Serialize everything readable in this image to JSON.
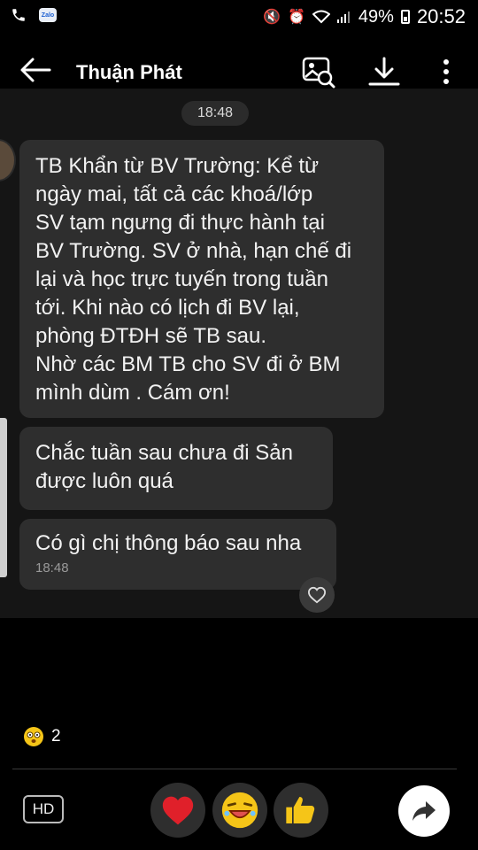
{
  "status_bar": {
    "app_badge": "Zalo",
    "battery": "49%",
    "time": "20:52"
  },
  "header": {
    "title": "Thuận Phát",
    "actions": [
      "search-media-icon",
      "download-icon",
      "more-vertical-icon"
    ]
  },
  "chat": {
    "time_separator": "18:48",
    "messages": [
      {
        "lines": [
          "TB Khẩn từ BV Trường: Kể từ",
          "ngày mai, tất cả các khoá/lớp",
          "SV tạm ngưng đi thực hành tại",
          "BV Trường. SV ở nhà, hạn chế đi",
          "lại và học trực tuyến trong tuần",
          "tới. Khi nào có lịch đi BV lại,",
          "phòng ĐTĐH sẽ TB sau.",
          "Nhờ các BM TB cho SV đi ở BM",
          "mình dùm . Cám ơn!"
        ]
      },
      {
        "lines": [
          "Chắc tuần sau chưa đi Sản",
          "được luôn quá"
        ]
      },
      {
        "lines": [
          "Có gì chị thông báo sau nha"
        ],
        "time": "18:48"
      }
    ]
  },
  "reactions": {
    "count": "2",
    "icon": "dizzy-face-icon"
  },
  "bottom_bar": {
    "hd_label": "HD",
    "emoji_buttons": [
      "heart-icon",
      "laughing-face-icon",
      "thumbs-up-icon"
    ],
    "share": "share-arrow-icon"
  },
  "colors": {
    "chat_background": "#151515",
    "bubble": "#2e2e2e",
    "heart": "#e0202a",
    "emoji_yellow": "#f5c518"
  }
}
